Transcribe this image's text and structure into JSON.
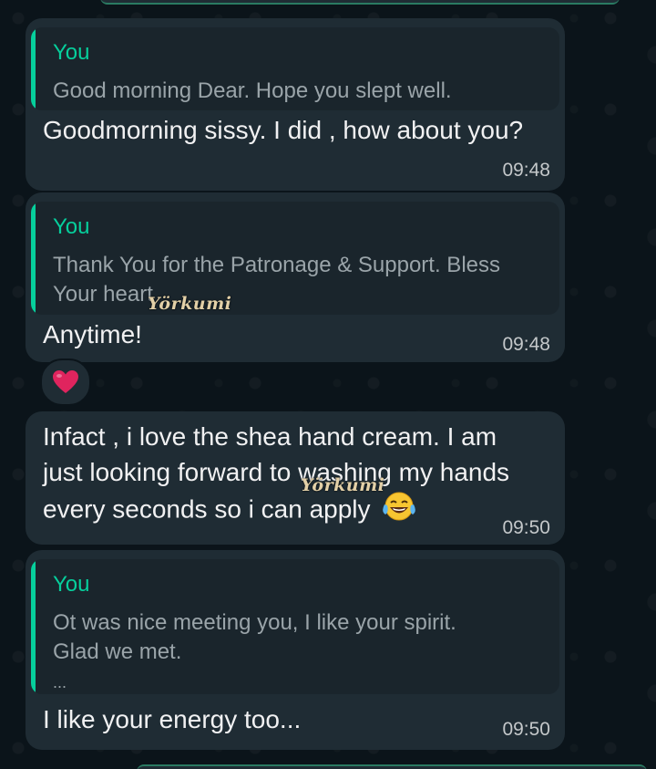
{
  "messages": [
    {
      "quote_author": "You",
      "quote_text": "Good morning Dear. Hope you slept well.",
      "text": "Goodmorning sissy. I did , how about you?",
      "time": "09:48"
    },
    {
      "quote_author": "You",
      "quote_text_line1": "Thank You for the Patronage & Support. Bless",
      "quote_text_line2": "Your heart",
      "text": "Anytime!",
      "time": "09:48"
    },
    {
      "text_line1": "Infact , i love the shea hand cream. I am",
      "text_line2": "just looking forward to washing my hands",
      "text_line3": "every seconds so i can apply",
      "time": "09:50"
    },
    {
      "quote_author": "You",
      "quote_text_line1": "Ot was nice meeting you, I like your spirit.",
      "quote_text_line2": "Glad we met.",
      "quote_ellipsis": "...",
      "text": "I like your energy too...",
      "time": "09:50"
    }
  ],
  "reaction": {
    "icon": "red-heart-icon",
    "color": "#e0245e"
  },
  "emoji": {
    "icon": "tears-of-joy-icon"
  },
  "watermark": {
    "text": "Yörkumi"
  },
  "colors": {
    "background": "#0b141a",
    "bubble": "#1f2c34",
    "quote_background": "#1a252c",
    "accent": "#06cf9c"
  }
}
